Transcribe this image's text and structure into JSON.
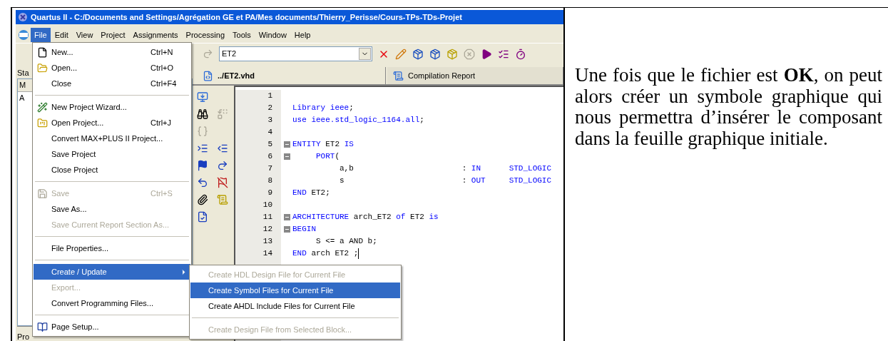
{
  "window": {
    "title": "Quartus II - C:/Documents and Settings/Agrégation GE et PA/Mes documents/Thierry_Perisse/Cours-TPs-TDs-Projet"
  },
  "menu_bar": [
    {
      "label": "File",
      "selected": true
    },
    {
      "label": "Edit",
      "selected": false
    },
    {
      "label": "View",
      "selected": false
    },
    {
      "label": "Project",
      "selected": false
    },
    {
      "label": "Assignments",
      "selected": false
    },
    {
      "label": "Processing",
      "selected": false
    },
    {
      "label": "Tools",
      "selected": false
    },
    {
      "label": "Window",
      "selected": false
    },
    {
      "label": "Help",
      "selected": false
    }
  ],
  "toolbar": {
    "project": "ET2"
  },
  "left_pane": {
    "title": "Sta",
    "header": "M",
    "item": "A",
    "bottom_tab": "Pro"
  },
  "editor_tabs": [
    {
      "label": "../ET2.vhd",
      "selected": true
    },
    {
      "label": "Compilation Report",
      "selected": false
    }
  ],
  "editor": {
    "lines": [
      {
        "number": "1",
        "fold": false,
        "cursor": false
      },
      {
        "number": "2",
        "fold": false,
        "cursor": false,
        "tokens": [
          {
            "text": "Library ieee",
            "kind": "keyword"
          },
          {
            "text": ";",
            "kind": "plain"
          }
        ]
      },
      {
        "number": "3",
        "fold": false,
        "cursor": false,
        "tokens": [
          {
            "text": "use ieee.std_logic_1164.all",
            "kind": "keyword"
          },
          {
            "text": ";",
            "kind": "plain"
          }
        ]
      },
      {
        "number": "4",
        "fold": false,
        "cursor": false
      },
      {
        "number": "5",
        "fold": true,
        "cursor": false,
        "tokens": [
          {
            "text": "ENTITY",
            "kind": "keyword"
          },
          {
            "text": " ET2 ",
            "kind": "plain"
          },
          {
            "text": "IS",
            "kind": "keyword"
          }
        ]
      },
      {
        "number": "6",
        "fold": true,
        "cursor": false,
        "tokens": [
          {
            "text": "     PORT",
            "kind": "keyword"
          },
          {
            "text": "(",
            "kind": "plain"
          }
        ]
      },
      {
        "number": "7",
        "fold": false,
        "cursor": false,
        "tokens": [
          {
            "text": "          a,b                       : ",
            "kind": "plain"
          },
          {
            "text": "IN      STD_LOGIC",
            "kind": "keyword"
          }
        ]
      },
      {
        "number": "8",
        "fold": false,
        "cursor": false,
        "tokens": [
          {
            "text": "          s                         : ",
            "kind": "plain"
          },
          {
            "text": "OUT     STD_LOGIC",
            "kind": "keyword"
          }
        ]
      },
      {
        "number": "9",
        "fold": false,
        "cursor": false,
        "tokens": [
          {
            "text": "END",
            "kind": "keyword"
          },
          {
            "text": " ET2;",
            "kind": "plain"
          }
        ]
      },
      {
        "number": "10",
        "fold": false,
        "cursor": false
      },
      {
        "number": "11",
        "fold": true,
        "cursor": false,
        "tokens": [
          {
            "text": "ARCHITECTURE",
            "kind": "keyword"
          },
          {
            "text": " arch_ET2 ",
            "kind": "plain"
          },
          {
            "text": "of",
            "kind": "keyword"
          },
          {
            "text": " ET2 ",
            "kind": "plain"
          },
          {
            "text": "is",
            "kind": "keyword"
          }
        ]
      },
      {
        "number": "12",
        "fold": true,
        "cursor": false,
        "tokens": [
          {
            "text": "BEGIN",
            "kind": "keyword"
          }
        ]
      },
      {
        "number": "13",
        "fold": false,
        "cursor": false,
        "tokens": [
          {
            "text": "     S <= a AND b;",
            "kind": "plain"
          }
        ]
      },
      {
        "number": "14",
        "fold": false,
        "cursor": true,
        "tokens": [
          {
            "text": "END",
            "kind": "keyword"
          },
          {
            "text": " arch ET2 ;",
            "kind": "plain"
          }
        ]
      }
    ]
  },
  "file_menu": [
    {
      "kind": "item",
      "label": "New...",
      "shortcut": "Ctrl+N",
      "disabled": false,
      "selected": false,
      "submenu": false
    },
    {
      "kind": "item",
      "label": "Open...",
      "shortcut": "Ctrl+O",
      "disabled": false,
      "selected": false,
      "submenu": false
    },
    {
      "kind": "item",
      "label": "Close",
      "shortcut": "Ctrl+F4",
      "disabled": false,
      "selected": false,
      "submenu": false
    },
    {
      "kind": "separator"
    },
    {
      "kind": "item",
      "label": "New Project Wizard...",
      "disabled": false,
      "selected": false,
      "submenu": false
    },
    {
      "kind": "item",
      "label": "Open Project...",
      "shortcut": "Ctrl+J",
      "disabled": false,
      "selected": false,
      "submenu": false
    },
    {
      "kind": "item",
      "label": "Convert MAX+PLUS II Project...",
      "disabled": false,
      "selected": false,
      "submenu": false
    },
    {
      "kind": "item",
      "label": "Save Project",
      "disabled": false,
      "selected": false,
      "submenu": false
    },
    {
      "kind": "item",
      "label": "Close Project",
      "disabled": false,
      "selected": false,
      "submenu": false
    },
    {
      "kind": "separator"
    },
    {
      "kind": "item",
      "label": "Save",
      "shortcut": "Ctrl+S",
      "disabled": true,
      "selected": false,
      "submenu": false
    },
    {
      "kind": "item",
      "label": "Save As...",
      "disabled": false,
      "selected": false,
      "submenu": false
    },
    {
      "kind": "item",
      "label": "Save Current Report Section As...",
      "disabled": true,
      "selected": false,
      "submenu": false
    },
    {
      "kind": "separator"
    },
    {
      "kind": "item",
      "label": "File Properties...",
      "disabled": false,
      "selected": false,
      "submenu": false
    },
    {
      "kind": "separator"
    },
    {
      "kind": "item",
      "label": "Create / Update",
      "disabled": false,
      "selected": true,
      "submenu": true
    },
    {
      "kind": "item",
      "label": "Export...",
      "disabled": true,
      "selected": false,
      "submenu": false
    },
    {
      "kind": "item",
      "label": "Convert Programming Files...",
      "disabled": false,
      "selected": false,
      "submenu": false
    },
    {
      "kind": "separator"
    },
    {
      "kind": "item",
      "label": "Page Setup...",
      "disabled": false,
      "selected": false,
      "submenu": false
    }
  ],
  "submenu": [
    {
      "kind": "item",
      "label": "Create HDL Design File for Current File",
      "disabled": true,
      "selected": false
    },
    {
      "kind": "item",
      "label": "Create Symbol Files for Current File",
      "disabled": false,
      "selected": true
    },
    {
      "kind": "item",
      "label": "Create AHDL Include Files for Current File",
      "disabled": false,
      "selected": false
    },
    {
      "kind": "separator"
    },
    {
      "kind": "item",
      "label": "Create Design File from Selected Block...",
      "disabled": true,
      "selected": false
    }
  ],
  "note": {
    "text": "Une fois que le fichier est **OK**, on peut alors créer un symbole graphique qui nous permettra d’insérer le composant dans la feuille graphique initiale."
  }
}
